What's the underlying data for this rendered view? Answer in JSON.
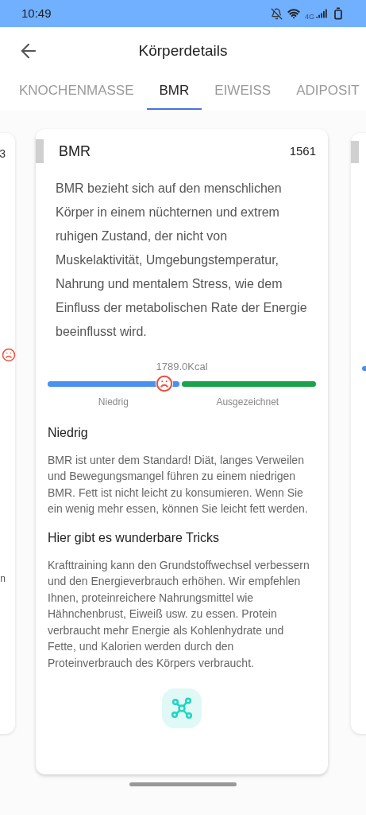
{
  "status_bar": {
    "time": "10:49",
    "network": "4G"
  },
  "header": {
    "title": "Körperdetails"
  },
  "tabs": [
    {
      "label": "KNOCHENMASSE",
      "selected": false
    },
    {
      "label": "BMR",
      "selected": true
    },
    {
      "label": "EIWEISS",
      "selected": false
    },
    {
      "label": "ADIPOSIT",
      "selected": false
    }
  ],
  "left_card": {
    "value": "3",
    "fragment": "n"
  },
  "card": {
    "title": "BMR",
    "value": "1561",
    "description": "BMR bezieht sich auf den menschlichen Körper in einem nüchternen und extrem ruhigen Zustand, der nicht von Muskelaktivität, Umgebungstemperatur, Nahrung und mentalem Stress, wie dem Einfluss der metabolischen Rate der Energie beeinflusst wird.",
    "gauge": {
      "reading": "1789.0Kcal",
      "level": 0.435,
      "segments": [
        {
          "label": "Niedrig",
          "color": "#4a90f0"
        },
        {
          "label": "Ausgezeichnet",
          "color": "#1aa34a"
        }
      ]
    },
    "sections": [
      {
        "heading": "Niedrig",
        "text": "BMR ist unter dem Standard! Diät, langes Verweilen und Bewegungsmangel führen zu einem niedrigen BMR. Fett ist nicht leicht zu konsumieren. Wenn Sie ein wenig mehr essen, können Sie leicht fett werden."
      },
      {
        "heading": "Hier gibt es wunderbare Tricks",
        "text": "Krafttraining kann den Grundstoffwechsel verbessern und den Energieverbrauch erhöhen. Wir empfehlen Ihnen, proteinreichere Nahrungsmittel wie Hähnchenbrust, Eiweiß usw. zu essen. Protein verbraucht mehr Energie als Kohlenhydrate und Fette, und Kalorien werden durch den Proteinverbrauch des Körpers verbraucht."
      }
    ]
  }
}
